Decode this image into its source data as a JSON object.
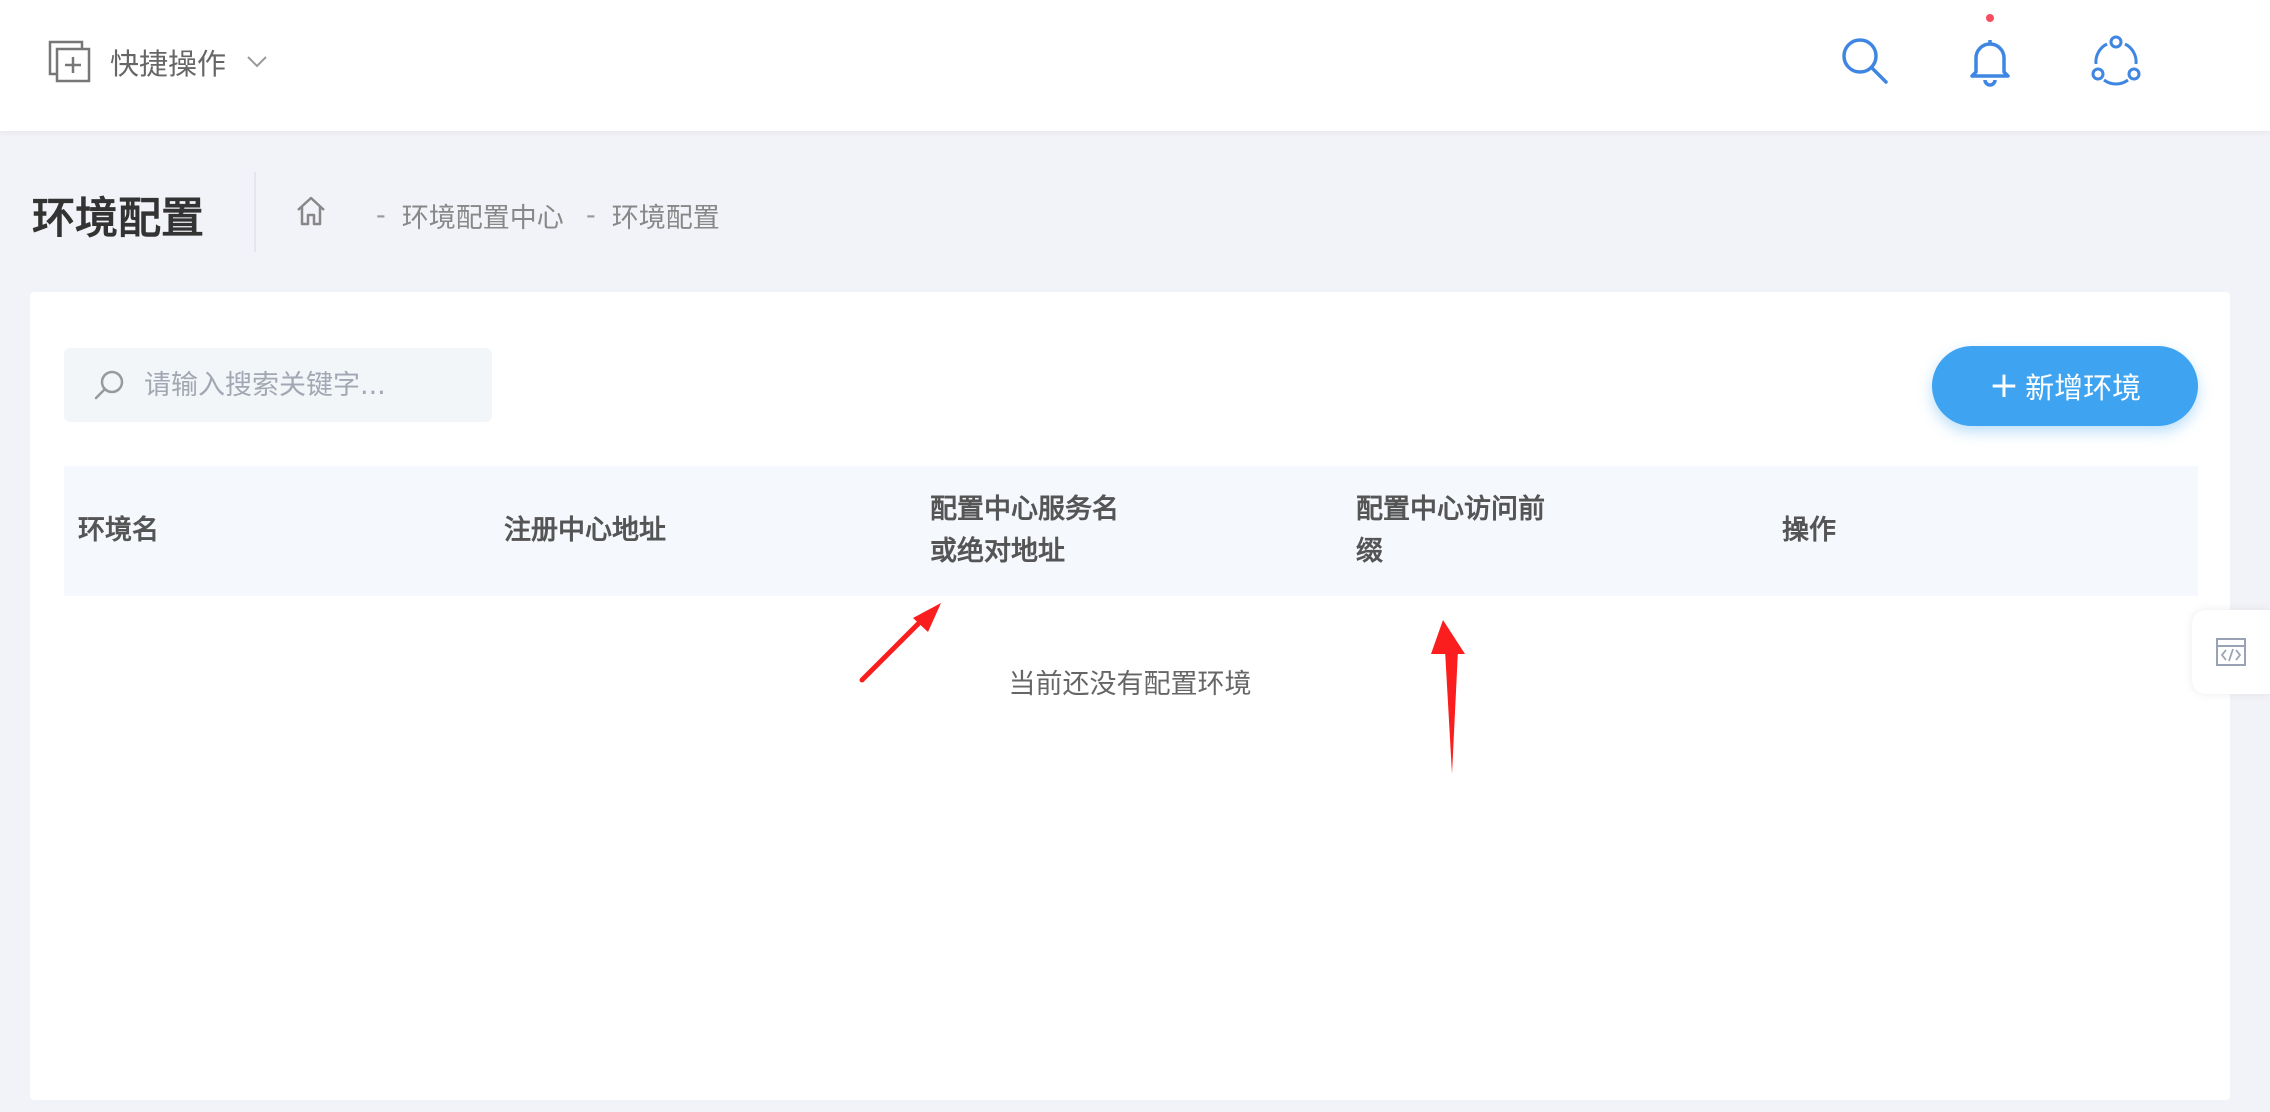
{
  "header": {
    "quick_ops_label": "快捷操作",
    "icons": [
      "quick-add-icon",
      "search-icon",
      "bell-icon",
      "share-icon"
    ],
    "accent": "#3f86e2",
    "notify_color": "#f64e60"
  },
  "page": {
    "title": "环境配置",
    "breadcrumb": [
      "环境配置中心",
      "环境配置"
    ]
  },
  "toolbar": {
    "search_placeholder": "请输入搜索关键字...",
    "add_label": "新增环境",
    "add_color": "#3ea3f0"
  },
  "table": {
    "columns": [
      [
        "环境名"
      ],
      [
        "注册中心地址"
      ],
      [
        "配置中心服务名",
        "或绝对地址"
      ],
      [
        "配置中心访问前",
        "缀"
      ],
      [
        "操作"
      ]
    ],
    "empty_text": "当前还没有配置环境"
  },
  "side_tab": {
    "icon": "code-window-icon"
  }
}
